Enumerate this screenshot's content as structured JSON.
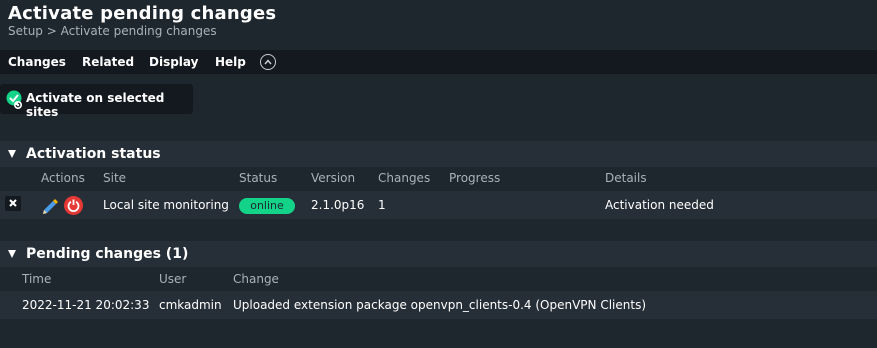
{
  "header": {
    "title": "Activate pending changes",
    "breadcrumb": "Setup > Activate pending changes"
  },
  "menu": {
    "items": [
      "Changes",
      "Related",
      "Display",
      "Help"
    ]
  },
  "activate_button": {
    "label": "Activate on selected sites"
  },
  "activation_status": {
    "title": "Activation status",
    "columns": [
      "Actions",
      "Site",
      "Status",
      "Version",
      "Changes",
      "Progress",
      "Details"
    ],
    "rows": [
      {
        "site": "Local site monitoring",
        "status": "online",
        "version": "2.1.0p16",
        "changes": "1",
        "progress": "",
        "details": "Activation needed"
      }
    ]
  },
  "pending_changes": {
    "title": "Pending changes (1)",
    "columns": [
      "Time",
      "User",
      "Change"
    ],
    "rows": [
      {
        "time": "2022-11-21 20:02:33",
        "user": "cmkadmin",
        "change": "Uploaded extension package openvpn_clients-0.4 (OpenVPN Clients)"
      }
    ]
  },
  "colors": {
    "background": "#1e262e",
    "menubar": "#14191f",
    "section": "#262e37",
    "status_online": "#13d389",
    "restart_red": "#e53935",
    "check_green": "#13d389"
  }
}
